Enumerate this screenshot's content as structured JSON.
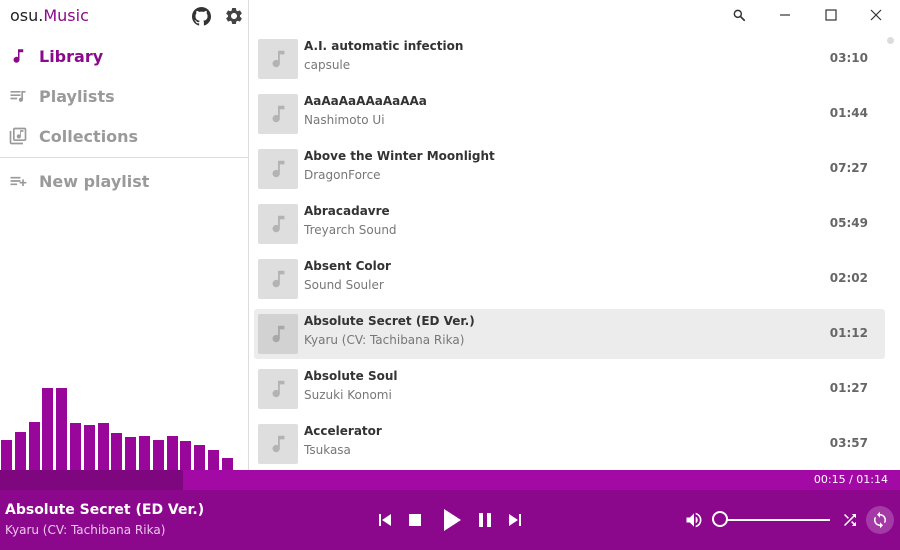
{
  "app": {
    "brand_prefix": "osu.",
    "brand_accent": "Music",
    "accent_color": "#8b0a8b"
  },
  "sidebar": {
    "items": [
      {
        "label": "Library",
        "icon": "music-note-icon",
        "active": true
      },
      {
        "label": "Playlists",
        "icon": "playlist-icon",
        "active": false
      },
      {
        "label": "Collections",
        "icon": "collections-icon",
        "active": false
      }
    ],
    "new_playlist_label": "New playlist",
    "visualizer_levels": [
      0.37,
      0.46,
      0.59,
      1.0,
      1.0,
      0.57,
      0.55,
      0.57,
      0.45,
      0.4,
      0.41,
      0.36,
      0.41,
      0.35,
      0.31,
      0.24,
      0.15
    ]
  },
  "tracks": [
    {
      "title": "A.I. automatic infection",
      "artist": "capsule",
      "duration": "03:10"
    },
    {
      "title": "AaAaAaAAaAaAAa",
      "artist": "Nashimoto Ui",
      "duration": "01:44"
    },
    {
      "title": "Above the Winter Moonlight",
      "artist": "DragonForce",
      "duration": "07:27"
    },
    {
      "title": "Abracadavre",
      "artist": "Treyarch Sound",
      "duration": "05:49"
    },
    {
      "title": "Absent Color",
      "artist": "Sound Souler",
      "duration": "02:02"
    },
    {
      "title": "Absolute Secret (ED Ver.)",
      "artist": "Kyaru (CV: Tachibana Rika)",
      "duration": "01:12",
      "selected": true
    },
    {
      "title": "Absolute Soul",
      "artist": "Suzuki Konomi",
      "duration": "01:27"
    },
    {
      "title": "Accelerator",
      "artist": "Tsukasa",
      "duration": "03:57"
    }
  ],
  "player": {
    "time": "00:15 / 01:14",
    "progress": 0.203,
    "now_playing_title": "Absolute Secret (ED Ver.)",
    "now_playing_artist": "Kyaru (CV: Tachibana Rika)",
    "volume": 0.0,
    "bar_color": "#8b088d"
  }
}
